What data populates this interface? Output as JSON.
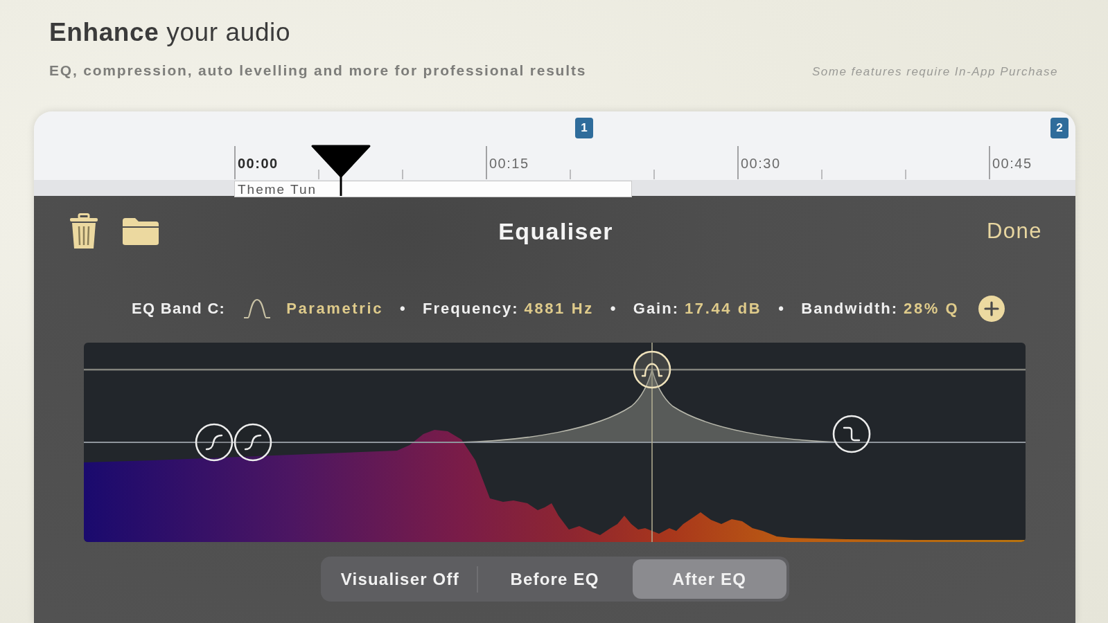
{
  "header": {
    "title": "**Enhance** your audio",
    "subtitle": "EQ, compression, auto levelling and more for professional results",
    "note": "Some features require In-App Purchase"
  },
  "timeline": {
    "markers": [
      "1",
      "2"
    ],
    "ticks": [
      {
        "label": "00:00",
        "bold": true
      },
      {
        "label": "00:15",
        "bold": false
      },
      {
        "label": "00:30",
        "bold": false
      },
      {
        "label": "00:45",
        "bold": false
      }
    ],
    "clip": {
      "title": "Theme Tun"
    }
  },
  "panel": {
    "title": "Equaliser",
    "done": "Done"
  },
  "band_info": {
    "label": "EQ Band C:",
    "type": "Parametric",
    "fields": [
      {
        "separator": "•",
        "label": "Frequency:",
        "value": "4881 Hz"
      },
      {
        "separator": "•",
        "label": "Gain:",
        "value": "17.44 dB"
      },
      {
        "separator": "•",
        "label": "Bandwidth:",
        "value": "28% Q"
      }
    ]
  },
  "eq_bands": [
    {
      "kind": "shelf",
      "selected": false
    },
    {
      "kind": "shelf",
      "selected": false
    },
    {
      "kind": "bell",
      "selected": true
    },
    {
      "kind": "cut",
      "selected": false
    }
  ],
  "visualiser": [
    {
      "label": "Visualiser Off",
      "selected": false
    },
    {
      "label": "Before EQ",
      "selected": false
    },
    {
      "label": "After EQ",
      "selected": true
    }
  ]
}
